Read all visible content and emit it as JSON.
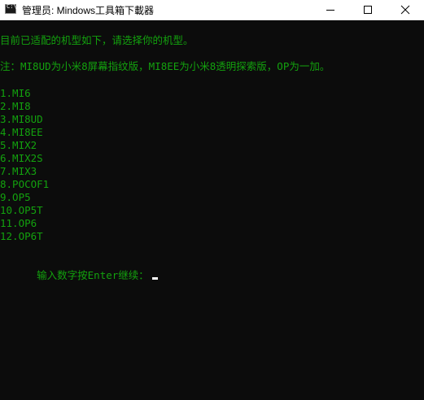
{
  "window": {
    "title": "管理员:  Mindows工具箱下載器",
    "app_icon": "cmd-icon",
    "caption_buttons": {
      "minimize": "minimize-icon",
      "maximize": "maximize-icon",
      "close": "close-icon"
    }
  },
  "console": {
    "colors": {
      "background": "#0c0c0c",
      "text": "#13a10e",
      "cursor": "#ffffff"
    },
    "intro": "目前已适配的机型如下，请选择你的机型。",
    "note": "注：MI8UD为小米8屏幕指纹版，MI8EE为小米8透明探索版，OP为一加。",
    "models": [
      "1.MI6",
      "2.MI8",
      "3.MI8UD",
      "4.MI8EE",
      "5.MIX2",
      "6.MIX2S",
      "7.MIX3",
      "8.POCOF1",
      "9.OP5",
      "10.OP5T",
      "11.OP6",
      "12.OP6T"
    ],
    "prompt": "输入数字按Enter继续："
  }
}
